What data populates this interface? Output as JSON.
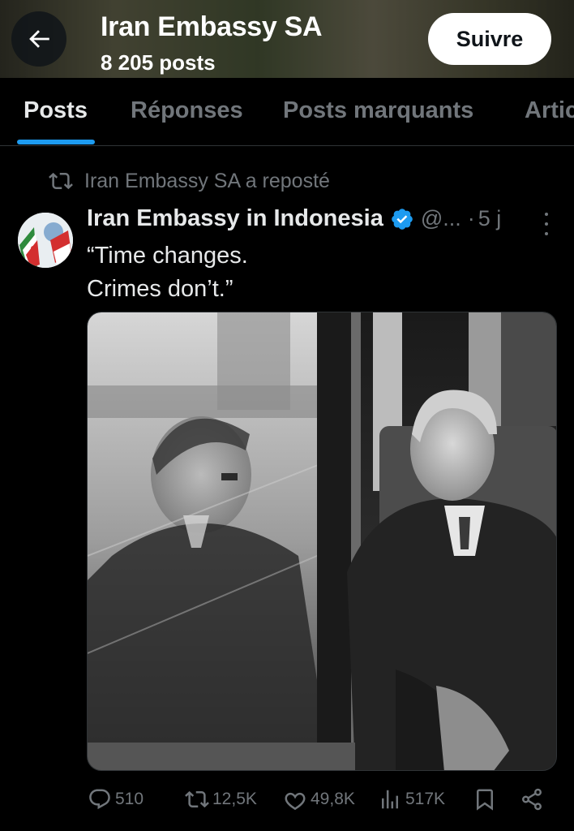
{
  "header": {
    "title": "Iran Embassy SA",
    "subtitle": "8 205 posts",
    "follow_label": "Suivre",
    "back_icon": "arrow-left-icon"
  },
  "tabs": [
    {
      "label": "Posts",
      "active": true
    },
    {
      "label": "Réponses",
      "active": false
    },
    {
      "label": "Posts marquants",
      "active": false
    },
    {
      "label": "Artic",
      "active": false
    }
  ],
  "repost": {
    "text": "Iran Embassy SA a reposté",
    "icon": "repost-icon"
  },
  "post": {
    "author": "Iran Embassy in Indonesia",
    "handle": "@...",
    "dot": "·",
    "time": "5 j",
    "verified_color": "#1d9bf0",
    "text_line1": "“Time changes.",
    "text_line2": "Crimes don’t.”",
    "actions": {
      "replies": "510",
      "reposts": "12,5K",
      "likes": "49,8K",
      "views": "517K"
    }
  },
  "colors": {
    "accent": "#1d9bf0",
    "muted": "#71767b",
    "background": "#000000"
  }
}
